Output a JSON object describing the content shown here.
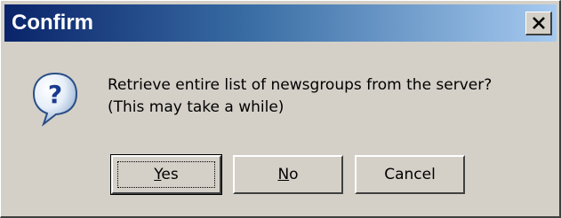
{
  "window": {
    "title": "Confirm",
    "close_icon": "close-icon"
  },
  "message": {
    "icon": "question-icon",
    "line1": "Retrieve entire list of newsgroups from the server?",
    "line2": "(This may take a while)"
  },
  "buttons": {
    "yes": {
      "accel": "Y",
      "rest": "es",
      "label": "Yes"
    },
    "no": {
      "accel": "N",
      "rest": "o",
      "label": "No"
    },
    "cancel": {
      "label": "Cancel"
    }
  },
  "colors": {
    "title_gradient_start": "#0a246a",
    "title_gradient_end": "#a6caf0",
    "dialog_face": "#d4d0c8"
  }
}
